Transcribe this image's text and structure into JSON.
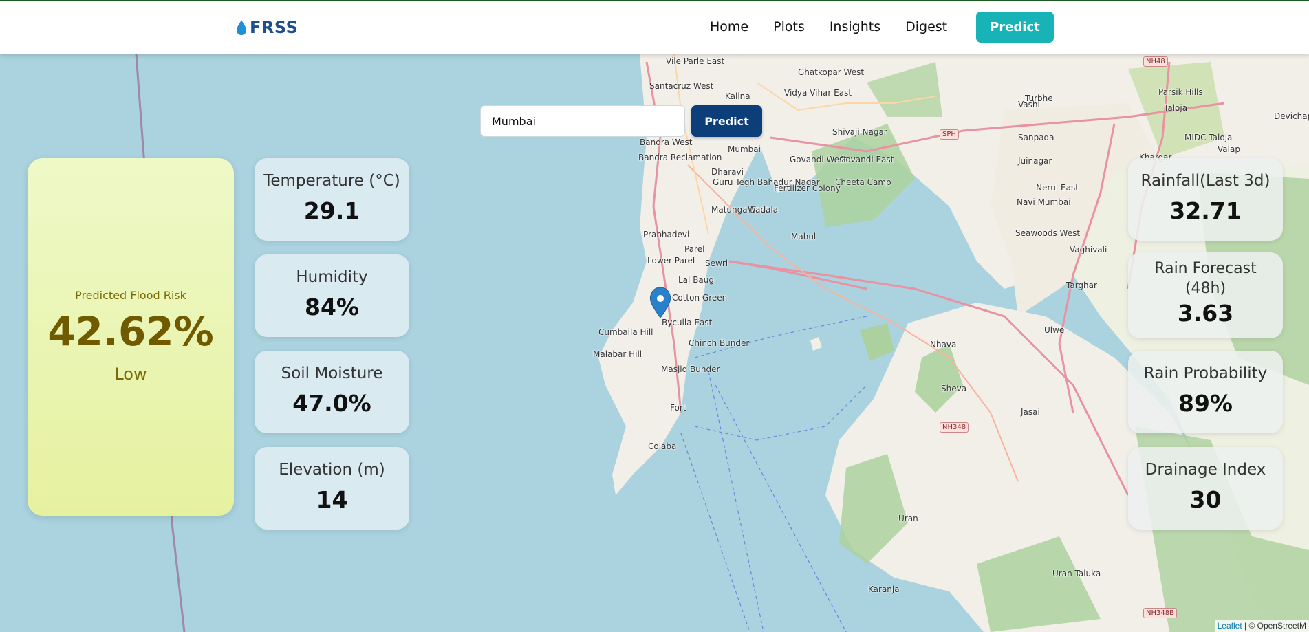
{
  "brand": {
    "name": "FRSS",
    "icon": "water-drop-icon",
    "color": "#1e4f8f"
  },
  "nav": {
    "links": [
      "Home",
      "Plots",
      "Insights",
      "Digest"
    ],
    "predict_label": "Predict",
    "predict_color": "#17b3b6"
  },
  "search": {
    "value": "Mumbai",
    "button_label": "Predict",
    "button_color": "#0c3e7a"
  },
  "risk": {
    "label": "Predicted Flood Risk",
    "value": "42.62%",
    "level": "Low"
  },
  "left_stats": [
    {
      "label": "Temperature (°C)",
      "value": "29.1"
    },
    {
      "label": "Humidity",
      "value": "84%"
    },
    {
      "label": "Soil Moisture",
      "value": "47.0%"
    },
    {
      "label": "Elevation (m)",
      "value": "14"
    }
  ],
  "right_stats": [
    {
      "label": "Rainfall(Last 3d)",
      "value": "32.71"
    },
    {
      "label": "Rain Forecast (48h)",
      "value": "3.63"
    },
    {
      "label": "Rain Probability",
      "value": "89%"
    },
    {
      "label": "Drainage Index",
      "value": "30"
    }
  ],
  "map": {
    "marker_icon": "map-pin-icon",
    "places": [
      "Vile Parle East",
      "Santacruz West",
      "Kalina",
      "Ghatkopar West",
      "Vidya Vihar East",
      "Vashi",
      "Turbhe",
      "Bandra West",
      "Bandra Reclamation",
      "Mumbai",
      "Shivaji Nagar",
      "Govandi East",
      "Govandi West",
      "Sanpada",
      "Juinagar",
      "Dharavi",
      "Guru Tegh Bahadur Nagar",
      "Fertilizer Colony",
      "Cheeta Camp",
      "Nerul East",
      "Navi Mumbai",
      "Matunga East",
      "Wadala",
      "Prabhadevi",
      "Mahul",
      "Seawoods West",
      "Parel",
      "Lower Parel",
      "Sewri",
      "Lal Baug",
      "Cotton Green",
      "Byculla East",
      "Cumballa Hill",
      "Chinch Bunder",
      "Malabar Hill",
      "Masjid Bunder",
      "Nhava",
      "Ulwe",
      "Targhar",
      "Sheva",
      "Fort",
      "Jasai",
      "Colaba",
      "Uran",
      "Karanja",
      "Uran Taluka",
      "Khargar",
      "Taloja",
      "MIDC Taloja",
      "Valap",
      "Parsik Hills",
      "Devichapada",
      "Vaghivali"
    ],
    "roads": [
      "NH48",
      "SPH",
      "NH348",
      "NH348B"
    ],
    "attribution_leaflet": "Leaflet",
    "attribution_rest": "| © OpenStreetM"
  }
}
